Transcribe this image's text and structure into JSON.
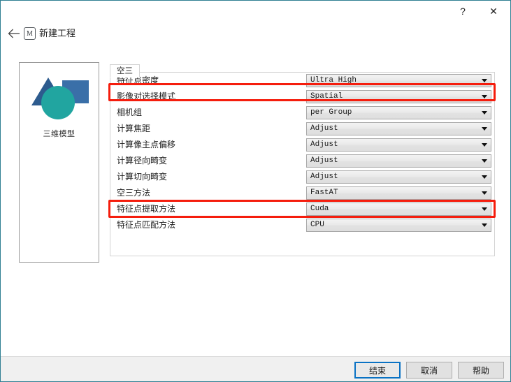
{
  "window": {
    "help_glyph": "?",
    "close_glyph": "✕",
    "back_glyph": "←",
    "app_badge": "M",
    "nav_title": "新建工程"
  },
  "preview": {
    "caption": "三维模型",
    "colors": {
      "triangle": "#2d5b8e",
      "square": "#3a6fa8",
      "circle": "#21a5a0"
    }
  },
  "settings": {
    "tabs": [
      {
        "label": "空三",
        "active": true
      }
    ],
    "rows": [
      {
        "label": "特征点密度",
        "value": "Ultra High",
        "highlighted": true
      },
      {
        "label": "影像对选择模式",
        "value": "Spatial",
        "highlighted": false
      },
      {
        "label": "相机组",
        "value": "per Group",
        "highlighted": false
      },
      {
        "label": "计算焦距",
        "value": "Adjust",
        "highlighted": false
      },
      {
        "label": "计算像主点偏移",
        "value": "Adjust",
        "highlighted": false
      },
      {
        "label": "计算径向畸变",
        "value": "Adjust",
        "highlighted": false
      },
      {
        "label": "计算切向畸变",
        "value": "Adjust",
        "highlighted": false
      },
      {
        "label": "空三方法",
        "value": "FastAT",
        "highlighted": true
      },
      {
        "label": "特征点提取方法",
        "value": "Cuda",
        "highlighted": false
      },
      {
        "label": "特征点匹配方法",
        "value": "CPU",
        "highlighted": false
      }
    ]
  },
  "footer": {
    "finish_label": "结束",
    "cancel_label": "取消",
    "help_label": "帮助"
  },
  "theme": {
    "window_border": "#2f7f93",
    "highlight": "#f51d0d",
    "primary_button_border": "#0a72c4",
    "footer_bg": "#f0f0f0"
  }
}
